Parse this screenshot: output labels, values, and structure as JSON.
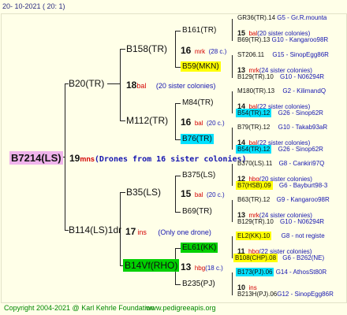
{
  "header": {
    "date": "20- 10-2021 ( 20: 1)"
  },
  "footer": {
    "copyright": "Copyright 2004-2021 @ Karl Kehrle Foundation",
    "url": "www.pedigreeapis.org"
  },
  "colors": {
    "background": "#ffffe8",
    "yellow": "#ffff00",
    "cyan": "#00e0ff",
    "green": "#00d000",
    "pink": "#f0b4ec"
  },
  "root": {
    "id": "B7214(LS)",
    "num": "19",
    "abbr": "mns",
    "note": "(Drones from 16 sister colonies)"
  },
  "gen1": [
    {
      "id": "B20(TR)",
      "num": "18",
      "abbr": "bal",
      "note": "(20 sister colonies)"
    },
    {
      "id": "B114(LS)1dr",
      "num": "17",
      "abbr": "ins",
      "note": "(Only one drone)"
    }
  ],
  "gen2": [
    {
      "id": "B158(TR)",
      "num": "16",
      "abbr": "mrk",
      "note": "(28 c.)"
    },
    {
      "id": "M112(TR)",
      "num": "16",
      "abbr": "bal",
      "note": "(20 c.)"
    },
    {
      "id": "B35(LS)",
      "num": "15",
      "abbr": "bal",
      "note": "(20 c.)"
    },
    {
      "id": "B14Vf(RHO)",
      "num": "13",
      "abbr": "hbg",
      "note": "(18 c.)"
    }
  ],
  "gen3": [
    {
      "id": "B161(TR)"
    },
    {
      "id": "B59(MKN)"
    },
    {
      "id": "M84(TR)"
    },
    {
      "id": "B76(TR)"
    },
    {
      "id": "B375(LS)"
    },
    {
      "id": "B69(TR)"
    },
    {
      "id": "EL61(KK)"
    },
    {
      "id": "B235(PJ)"
    }
  ],
  "gen4": [
    {
      "top": "GR36(TR).14",
      "topInfo": "G5 - Gr.R.mounta",
      "num": "15",
      "abbr": "bal",
      "note": "(20 sister colonies)",
      "bottom": "B69(TR).13",
      "bottomInfo": "G10 - Kangaroo98R"
    },
    {
      "top": "ST206.11",
      "topInfo": "G15 - SinopEgg86R",
      "num": "13",
      "abbr": "mrk",
      "note": "(24 sister colonies)",
      "bottom": "B129(TR).10",
      "bottomInfo": "G10 - N06294R"
    },
    {
      "top": "M180(TR).13",
      "topInfo": "G2 - KilimandQ",
      "num": "14",
      "abbr": "bal",
      "note": "(22 sister colonies)",
      "bottom": "B54(TR).12",
      "bottomInfo": "G26 - Sinop62R"
    },
    {
      "top": "B79(TR).12",
      "topInfo": "G10 - Takab93aR",
      "num": "14",
      "abbr": "bal",
      "note": "(22 sister colonies)",
      "bottom": "B54(TR).12",
      "bottomInfo": "G26 - Sinop62R"
    },
    {
      "top": "B370(LS).11",
      "topInfo": "G8 - Cankiri97Q",
      "num": "12",
      "abbr": "hbg",
      "note": "(20 sister colonies)",
      "bottom": "B7(HSB).09",
      "bottomInfo": "G6 - Bayburt98-3"
    },
    {
      "top": "B63(TR).12",
      "topInfo": "G9 - Kangaroo98R",
      "num": "13",
      "abbr": "mrk",
      "note": "(24 sister colonies)",
      "bottom": "B129(TR).10",
      "bottomInfo": "G10 - N06294R"
    },
    {
      "top": "EL2(KK).10",
      "topInfo": "G8 - not registe",
      "num": "11",
      "abbr": "hbg",
      "note": "(22 sister colonies)",
      "bottom": "B108(CHP).08",
      "bottomInfo": "G6 - B262(NE)"
    },
    {
      "top": "B173(PJ).06",
      "topInfo": "G14 - AthosSt80R",
      "num": "10",
      "abbr": "ins",
      "note": "",
      "bottom": "B213H(PJ).06",
      "bottomInfo": "G12 - SinopEgg86R"
    }
  ]
}
